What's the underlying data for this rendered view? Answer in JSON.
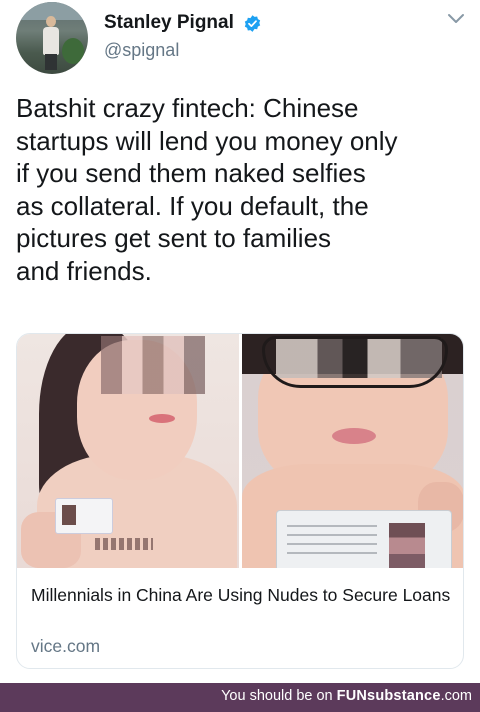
{
  "tweet": {
    "author": {
      "display_name": "Stanley Pignal",
      "handle": "@spignal",
      "verified": true
    },
    "text": "Batshit crazy fintech: Chinese\nstartups will lend you money only\nif you send them naked selfies\nas collateral. If you default, the\npictures get sent to families\nand friends.",
    "card": {
      "title": "Millennials in China Are Using Nudes to Secure Loans",
      "domain": "vice.com"
    }
  },
  "footer": {
    "prefix": "You should be on ",
    "brand": "FUNsubstance",
    "suffix": ".com"
  },
  "icons": {
    "verified": "verified-badge-icon",
    "menu": "chevron-down-icon"
  },
  "colors": {
    "verified_blue": "#1da1f2",
    "footer_bg": "#5c3a5b",
    "secondary_text": "#657786"
  }
}
